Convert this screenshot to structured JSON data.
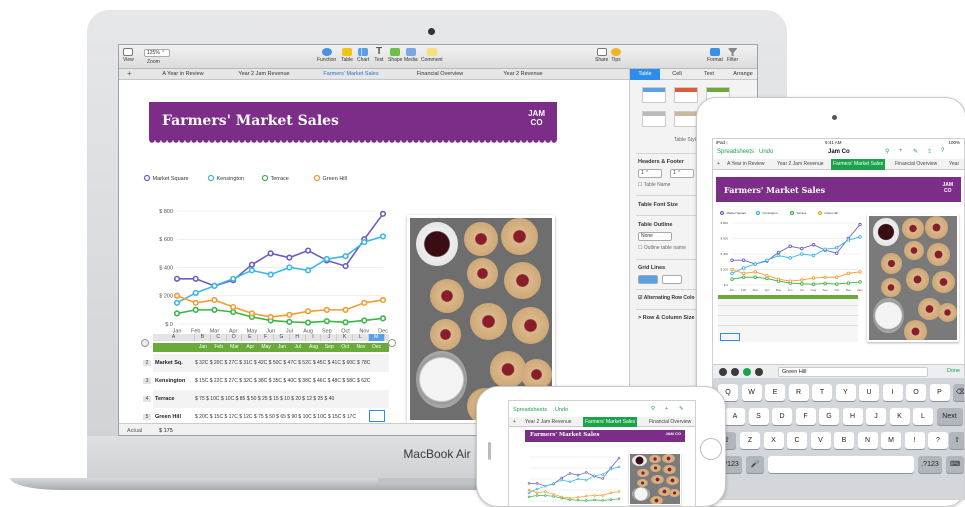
{
  "mac": {
    "device_label": "MacBook Air",
    "toolbar": {
      "zoom_value": "125% ⌃",
      "items": [
        {
          "label": "View",
          "name": "toolbar-view-button"
        },
        {
          "label": "Zoom",
          "name": "toolbar-zoom-label"
        },
        {
          "label": "Function",
          "name": "toolbar-function-button"
        },
        {
          "label": "Table",
          "name": "toolbar-table-button"
        },
        {
          "label": "Chart",
          "name": "toolbar-chart-button"
        },
        {
          "label": "Text",
          "name": "toolbar-text-button"
        },
        {
          "label": "Shape",
          "name": "toolbar-shape-button"
        },
        {
          "label": "Media",
          "name": "toolbar-media-button"
        },
        {
          "label": "Comment",
          "name": "toolbar-comment-button"
        },
        {
          "label": "Share",
          "name": "toolbar-share-button"
        },
        {
          "label": "Tips",
          "name": "toolbar-tips-button"
        },
        {
          "label": "Format",
          "name": "toolbar-format-button"
        },
        {
          "label": "Filter",
          "name": "toolbar-filter-button"
        }
      ]
    },
    "sheet_tabs": [
      "A Year in Review",
      "Year 2 Jam Revenue",
      "Farmers' Market Sales",
      "Financial Overview",
      "Year 2 Revenue"
    ],
    "inspector": {
      "tabs": [
        "Table",
        "Cell",
        "Text",
        "Arrange"
      ],
      "table_styles_label": "Table Style",
      "headers_footer": "Headers & Footer",
      "header_rows_value": "1 ⌃",
      "header_cols_value": "1 ⌃",
      "table_name": "Table Name",
      "table_font_size": "Table Font Size",
      "table_outline": "Table Outline",
      "outline_value": "None",
      "outline_table_name": "Outline table name",
      "grid_lines": "Grid Lines",
      "alternating_row_color": "Alternating Row Colo",
      "row_column_size": "Row & Column Size"
    },
    "sheet": {
      "banner_title": "Farmers' Market Sales",
      "logo_line1": "JAM",
      "logo_line2": "CO",
      "table": {
        "column_letters": [
          "A",
          "B",
          "C",
          "D",
          "E",
          "F",
          "G",
          "H",
          "I",
          "J",
          "K",
          "L",
          "M"
        ],
        "header": [
          "Jan",
          "Feb",
          "Mar",
          "Apr",
          "May",
          "Jun",
          "Jul",
          "Aug",
          "Sep",
          "Oct",
          "Nov",
          "Dec"
        ],
        "rows": [
          {
            "num": "2",
            "label": "Market Sq.",
            "values": "$ 32C $ 20C $ 27C $ 31C $ 42C $ 50C $ 47C $ 52C $ 45C $ 41C $ 60C $ 78C"
          },
          {
            "num": "3",
            "label": "Kensington",
            "values": "$ 15C $ 22C $ 27C $ 32C $ 38C $ 35C $ 40C $ 38C $ 46C $ 48C $ 58C $ 62C"
          },
          {
            "num": "4",
            "label": "Terrace",
            "values": "$ 75  $ 10C $ 10C $ 85  $ 50  $ 25  $ 15  $ 10  $ 20  $ 12  $ 25  $ 40"
          },
          {
            "num": "5",
            "label": "Green Hill",
            "values": "$ 20C $ 15C $ 17C $ 12C $ 75  $ 50  $ 65  $ 90  $ 10C $ 10C $ 15C $ 17C"
          }
        ]
      },
      "status_label": "Actual",
      "status_value": "$ 175"
    }
  },
  "chart_data": {
    "type": "line",
    "categories": [
      "Jan",
      "Feb",
      "Mar",
      "Apr",
      "May",
      "Jun",
      "Jul",
      "Aug",
      "Sep",
      "Oct",
      "Nov",
      "Dec"
    ],
    "ylim": [
      0,
      800
    ],
    "yticks": [
      "$ 800",
      "$ 600",
      "$ 400",
      "$ 200",
      "$ 0"
    ],
    "series": [
      {
        "name": "Market Square",
        "color": "#6a5fc1",
        "values": [
          320,
          320,
          270,
          310,
          420,
          500,
          470,
          520,
          450,
          410,
          600,
          780
        ]
      },
      {
        "name": "Kensington",
        "color": "#3db6e4",
        "values": [
          150,
          220,
          270,
          320,
          380,
          350,
          400,
          380,
          460,
          480,
          580,
          620
        ]
      },
      {
        "name": "Terrace",
        "color": "#3bb54a",
        "values": [
          75,
          100,
          100,
          85,
          50,
          25,
          15,
          10,
          20,
          12,
          25,
          40
        ]
      },
      {
        "name": "Green Hill",
        "color": "#f39c35",
        "values": [
          200,
          150,
          170,
          120,
          75,
          50,
          65,
          90,
          100,
          100,
          150,
          170
        ]
      }
    ]
  },
  "ipad": {
    "status_left": "iPad ⁝",
    "status_time": "9:41 AM",
    "status_right": "100%",
    "nav_back": "Spreadsheets",
    "nav_undo": "Undo",
    "doc_title": "Jam Co",
    "tabs": [
      "+",
      "A Year in Review",
      "Year 2 Jam Revenue",
      "Farmers' Market Sales",
      "Financial Overview",
      "Year"
    ],
    "banner_title": "Farmers' Market Sales",
    "logo_line1": "JAM",
    "logo_line2": "CO",
    "formula_value": "Green Hill",
    "done_label": "Done",
    "keys_row1": [
      "Q",
      "W",
      "E",
      "R",
      "T",
      "Y",
      "U",
      "I",
      "O",
      "P"
    ],
    "keys_row2": [
      "A",
      "S",
      "D",
      "F",
      "G",
      "H",
      "J",
      "K",
      "L",
      "Next"
    ],
    "keys_row3": [
      "Z",
      "X",
      "C",
      "V",
      "B",
      "N",
      "M",
      "!",
      "?"
    ],
    "key_numbers": ".?123",
    "key_numbers2": ".?123"
  },
  "iphone": {
    "nav_back": "Spreadsheets",
    "nav_undo": "Undo",
    "tabs": [
      "+",
      "Year 2 Jam Revenue",
      "Farmers' Market Sales",
      "Financial Overview"
    ],
    "banner_title": "Farmers' Market Sales",
    "logo": "JAM CO"
  }
}
